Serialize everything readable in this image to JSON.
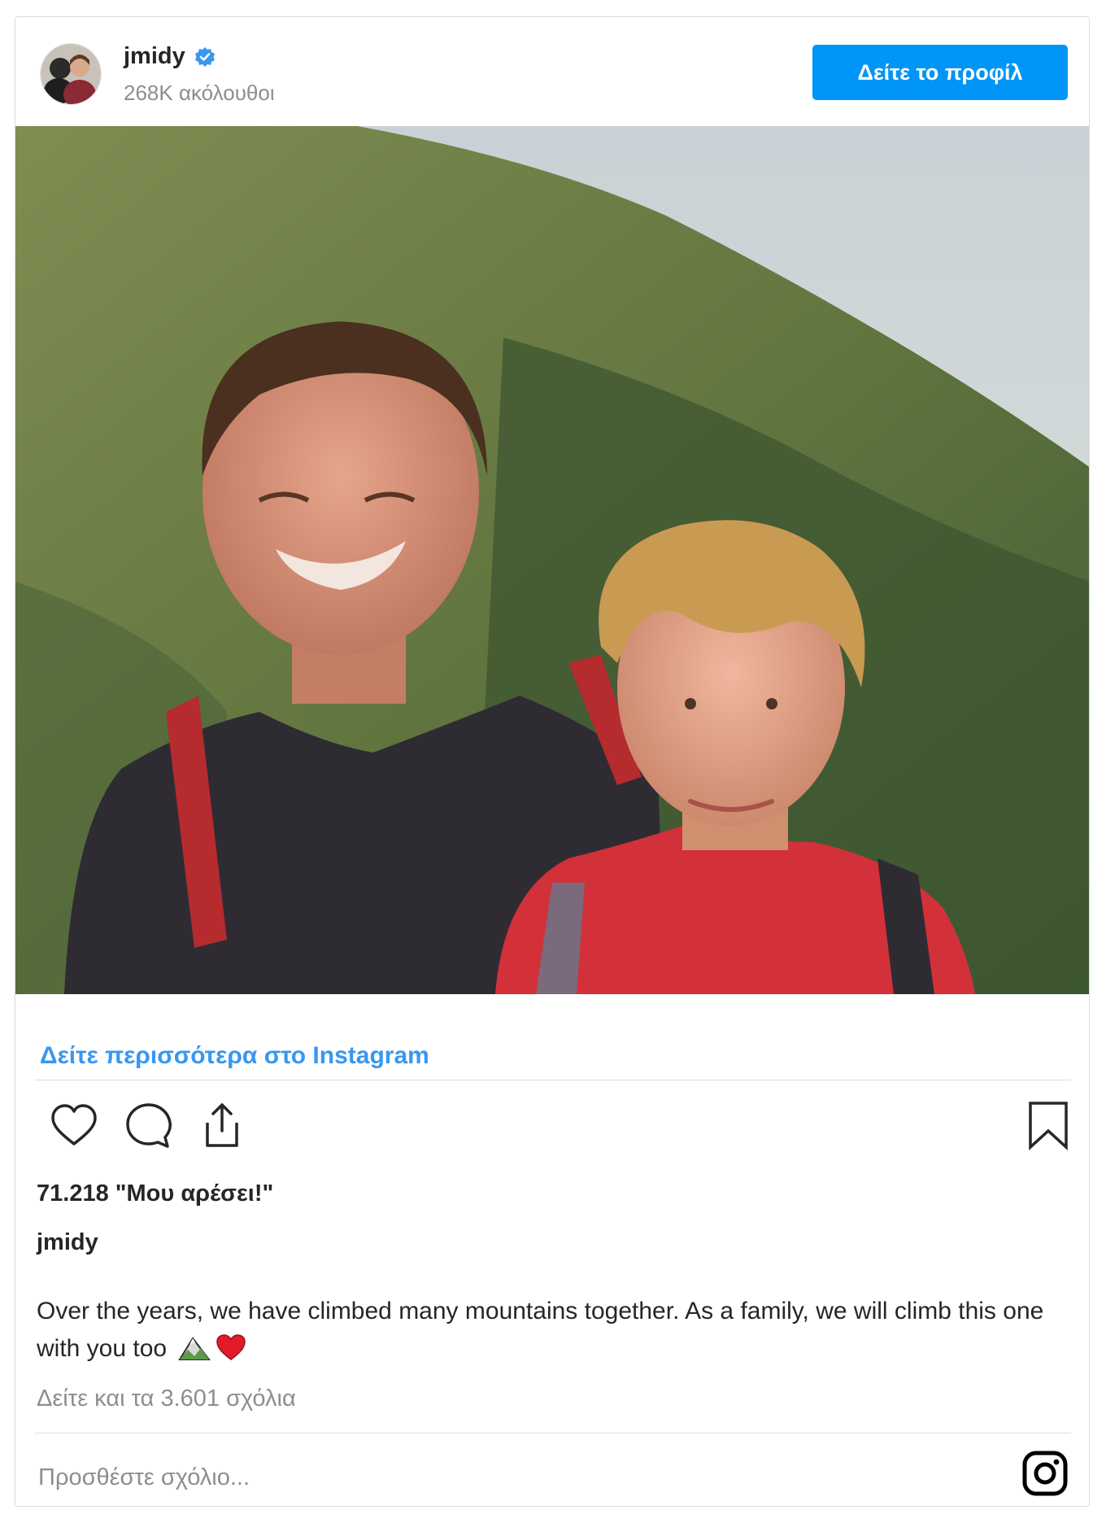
{
  "header": {
    "username": "jmidy",
    "verified": true,
    "followers": "268K ακόλουθοι",
    "profile_button": "Δείτε το προφίλ"
  },
  "post": {
    "image_alt": "",
    "see_more": "Δείτε περισσότερα στο Instagram",
    "actions": [
      "heart-icon",
      "comment-icon",
      "share-icon",
      "bookmark-icon"
    ],
    "likes": "71.218 \"Μου αρέσει!\"",
    "caption_user": "jmidy",
    "caption_text": "Over the years, we have climbed many mountains together. As a family, we will climb this one with you too",
    "caption_emojis": [
      "mountain-emoji",
      "heart-emoji"
    ],
    "view_comments": "Δείτε και τα 3.601 σχόλια"
  },
  "comment": {
    "placeholder": "Προσθέστε σχόλιο..."
  },
  "colors": {
    "accent": "#0095f6",
    "link": "#3897f0",
    "muted": "#8e8e8e",
    "border": "#dbdbdb"
  }
}
